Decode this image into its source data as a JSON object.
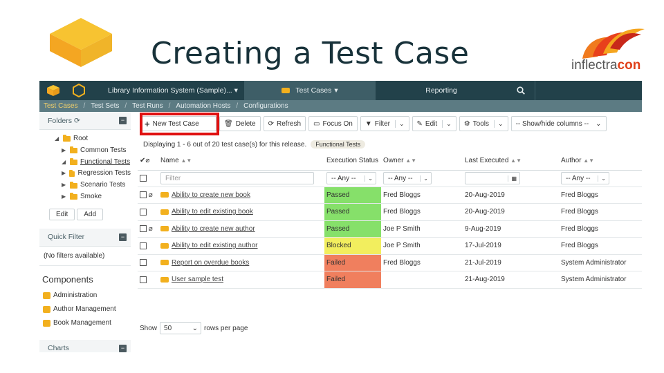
{
  "slide": {
    "title": "Creating a Test Case",
    "brand_part1": "inflectra",
    "brand_part2": "con"
  },
  "topbar": {
    "project": "Library Information System (Sample)...",
    "active_tab": "Test Cases",
    "reporting": "Reporting"
  },
  "subnav": [
    "Test Cases",
    "Test Sets",
    "Test Runs",
    "Automation Hosts",
    "Configurations"
  ],
  "sidebar": {
    "folders_label": "Folders",
    "tree": [
      {
        "label": "Root"
      },
      {
        "label": "Common Tests"
      },
      {
        "label": "Functional Tests"
      },
      {
        "label": "Regression Tests"
      },
      {
        "label": "Scenario Tests"
      },
      {
        "label": "Smoke"
      }
    ],
    "edit_label": "Edit",
    "add_label": "Add",
    "quick_filter_label": "Quick Filter",
    "no_filters": "(No filters available)",
    "components_label": "Components",
    "components": [
      "Administration",
      "Author Management",
      "Book Management"
    ],
    "charts_label": "Charts"
  },
  "toolbar": {
    "new_label": "New Test Case",
    "delete_label": "Delete",
    "refresh_label": "Refresh",
    "focus_label": "Focus On",
    "filter_label": "Filter",
    "edit_label": "Edit",
    "tools_label": "Tools",
    "columns_label": "-- Show/hide columns --"
  },
  "display": {
    "text": "Displaying 1 - 6 out of 20 test case(s) for this release.",
    "tag": "Functional Tests"
  },
  "grid": {
    "headers": {
      "name": "Name",
      "status": "Execution Status",
      "owner": "Owner",
      "last_executed": "Last Executed",
      "author": "Author"
    },
    "filter": {
      "placeholder": "Filter",
      "any": "-- Any --"
    },
    "rows": [
      {
        "name": "Ability to create new book",
        "status": "Passed",
        "owner": "Fred Bloggs",
        "last": "20-Aug-2019",
        "author": "Fred Bloggs"
      },
      {
        "name": "Ability to edit existing book",
        "status": "Passed",
        "owner": "Fred Bloggs",
        "last": "20-Aug-2019",
        "author": "Fred Bloggs"
      },
      {
        "name": "Ability to create new author",
        "status": "Passed",
        "owner": "Joe P Smith",
        "last": "9-Aug-2019",
        "author": "Fred Bloggs"
      },
      {
        "name": "Ability to edit existing author",
        "status": "Blocked",
        "owner": "Joe P Smith",
        "last": "17-Jul-2019",
        "author": "Fred Bloggs"
      },
      {
        "name": "Report on overdue books",
        "status": "Failed",
        "owner": "Fred Bloggs",
        "last": "21-Jul-2019",
        "author": "System Administrator"
      },
      {
        "name": "User sample test",
        "status": "Failed",
        "owner": "",
        "last": "21-Aug-2019",
        "author": "System Administrator"
      }
    ]
  },
  "paging": {
    "show": "Show",
    "page_size": "50",
    "rows_per_page": "rows per page"
  },
  "colors": {
    "topbar": "#22414a",
    "subbar": "#5c7b83",
    "passed": "#86e06a",
    "blocked": "#f2ee5e",
    "failed": "#f07f5e",
    "highlight": "#e01010",
    "accent": "#f2b01e"
  }
}
